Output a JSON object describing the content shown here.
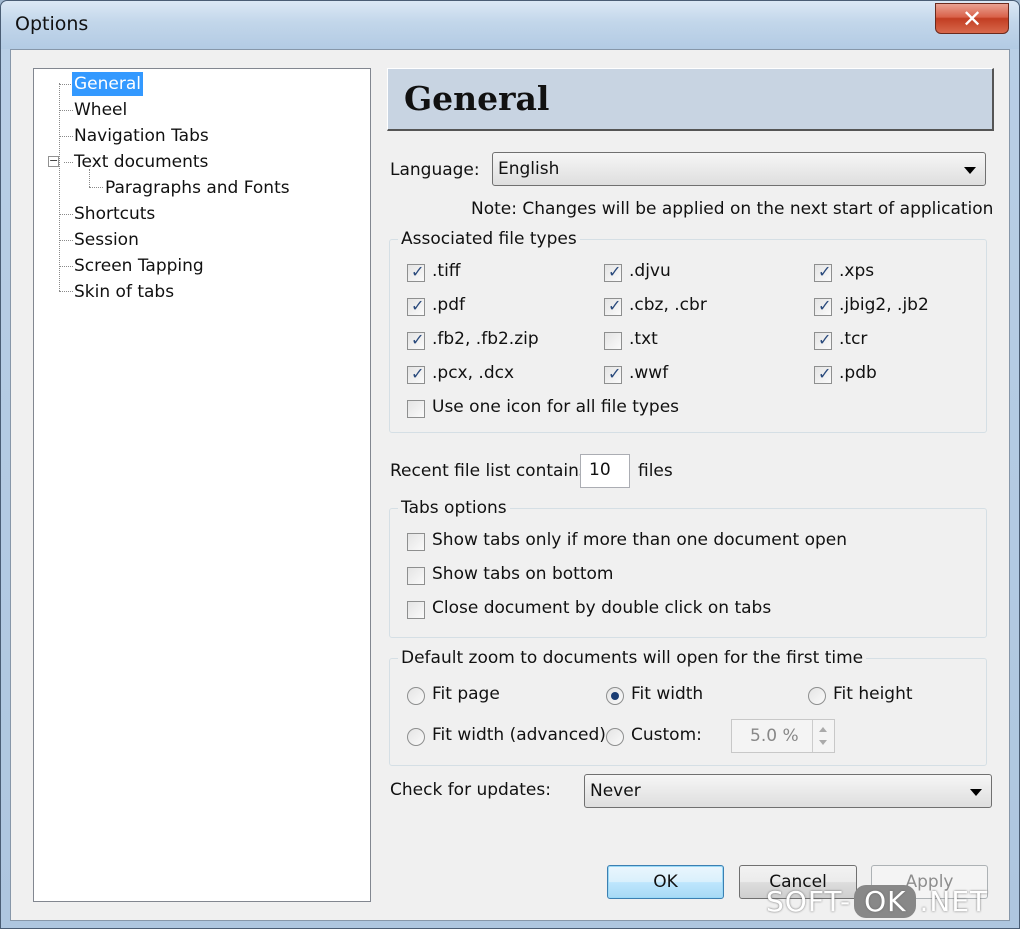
{
  "window": {
    "title": "Options",
    "close_glyph": "✕"
  },
  "tree": {
    "items": [
      {
        "label": "General",
        "selected": true
      },
      {
        "label": "Wheel"
      },
      {
        "label": "Navigation Tabs"
      },
      {
        "label": "Text documents",
        "expanded": true,
        "children": [
          {
            "label": "Paragraphs and Fonts"
          }
        ]
      },
      {
        "label": "Shortcuts"
      },
      {
        "label": "Session"
      },
      {
        "label": "Screen Tapping"
      },
      {
        "label": "Skin of tabs"
      }
    ],
    "expander_glyph": "−"
  },
  "header": {
    "title": "General"
  },
  "language": {
    "label": "Language:",
    "value": "English"
  },
  "note": "Note: Changes will be applied on the next start of application",
  "assoc": {
    "title": "Associated file types",
    "items": [
      {
        "label": ".tiff",
        "checked": true
      },
      {
        "label": ".djvu",
        "checked": true
      },
      {
        "label": ".xps",
        "checked": true
      },
      {
        "label": ".pdf",
        "checked": true
      },
      {
        "label": ".cbz, .cbr",
        "checked": true
      },
      {
        "label": ".jbig2, .jb2",
        "checked": true
      },
      {
        "label": ".fb2, .fb2.zip",
        "checked": true
      },
      {
        "label": ".txt",
        "checked": false
      },
      {
        "label": ".tcr",
        "checked": true
      },
      {
        "label": ".pcx, .dcx",
        "checked": true
      },
      {
        "label": ".wwf",
        "checked": true
      },
      {
        "label": ".pdb",
        "checked": true
      }
    ],
    "one_icon": {
      "label": "Use one icon for all file types",
      "checked": false
    },
    "check_glyph": "✓"
  },
  "recent": {
    "label": "Recent file list contains:",
    "value": "10",
    "suffix": "files"
  },
  "tabs_options": {
    "title": "Tabs options",
    "items": [
      {
        "label": "Show tabs only if more than one document open",
        "checked": false
      },
      {
        "label": "Show tabs on bottom",
        "checked": false
      },
      {
        "label": "Close document by double click on tabs",
        "checked": false
      }
    ]
  },
  "zoom": {
    "title": "Default zoom to documents will open for the first time",
    "fit_page": "Fit page",
    "fit_width": "Fit width",
    "fit_height": "Fit height",
    "fit_width_adv": "Fit width (advanced)",
    "custom": "Custom:",
    "custom_value": "5.0 %",
    "selected": "Fit width"
  },
  "updates": {
    "label": "Check for updates:",
    "value": "Never"
  },
  "buttons": {
    "ok": "OK",
    "cancel": "Cancel",
    "apply": "Apply"
  },
  "watermark": {
    "left": "SOFT-",
    "ok": "OK",
    "right": ".NET"
  }
}
